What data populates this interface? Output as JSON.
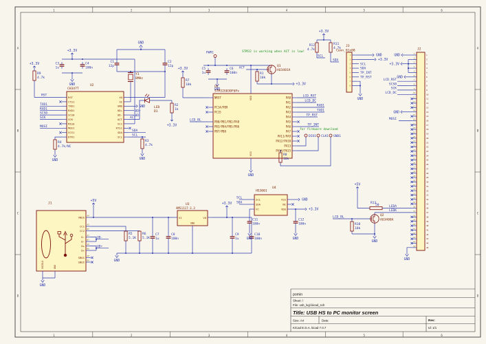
{
  "colors": {
    "bg": "#f8f5ec",
    "wire": "#2936ad",
    "symbol": "#7d0d0d",
    "fill": "#fdf6c3",
    "pin_number": "#7f7600",
    "pin_name": "#7d2500",
    "ic_text": "#7d2500",
    "comment": "#1f9522",
    "frame": "#3c3c3c",
    "titleblock": "#111111"
  },
  "frame": {
    "columns": [
      "1",
      "2",
      "3",
      "4",
      "5",
      "6"
    ],
    "rows": [
      "A",
      "B",
      "C",
      "D"
    ]
  },
  "title_block": {
    "author": "pomin",
    "sheet": "Sheet: /",
    "file": "File: usb_lvgl.kicad_sch",
    "title": "Title: USB HS to PC monitor screen",
    "size_label": "Size: A4",
    "date_label": "Date:",
    "rev_label": "Rev:",
    "tool": "KiCad E.D.A.  kicad 7.0.7",
    "id": "Id: 1/1"
  },
  "comments": {
    "act": "STM32 is working when ACT is low!",
    "firmware": "for firmware download"
  },
  "power": {
    "p3v3": "+3.3V",
    "p5v": "+5V",
    "gnd": "GND"
  },
  "net_labels": {
    "rst": "RST",
    "txd1": "TXD1",
    "rxd1": "RXD1",
    "scs0": "SCS0",
    "sck": "SCK",
    "mosi": "MOSI",
    "udp": "UD+",
    "udm": "UD-",
    "act": "ACT",
    "sda": "SDA",
    "scl": "SCL",
    "lcd_rst": "LCD_RST",
    "lcd_dc": "LCD_DC",
    "tp_rst": "TP_RST",
    "tp_int": "TP_INT",
    "lcd_bl": "LCD_BL",
    "leda": "LEDA",
    "ledk": "LEDK"
  },
  "testpoints": {
    "pwr": {
      "ref": "PWR1"
    },
    "dio": {
      "ref": "DIO1"
    },
    "clk": {
      "ref": "CLK1"
    },
    "gnd1": {
      "ref": "GND1"
    }
  },
  "resistors": {
    "R1": {
      "ref": "R1",
      "value": "10k"
    },
    "R2": {
      "ref": "R2",
      "value": "1k"
    },
    "R3": {
      "ref": "R3",
      "value": "4.7k"
    },
    "R4": {
      "ref": "R4",
      "value": "4.7k/NC"
    },
    "R5": {
      "ref": "R5",
      "value": "5.1K"
    },
    "R6": {
      "ref": "R6",
      "value": "5.1K"
    },
    "R7": {
      "ref": "R7",
      "value": "10k"
    },
    "R8": {
      "ref": "R8",
      "value": "10k"
    },
    "R9": {
      "ref": "R9",
      "value": "4.7k"
    },
    "R10": {
      "ref": "R10",
      "value": "10k"
    },
    "R11": {
      "ref": "R11",
      "value": "4.7k"
    },
    "R12": {
      "ref": "R12",
      "value": "4.7k"
    },
    "R13": {
      "ref": "R13",
      "value": "50"
    }
  },
  "capacitors": {
    "C1": {
      "ref": "C1",
      "value": "12p"
    },
    "C2": {
      "ref": "C2",
      "value": "12p"
    },
    "C3": {
      "ref": "C3",
      "value": "1u"
    },
    "C4": {
      "ref": "C4",
      "value": "100n"
    },
    "C5": {
      "ref": "C5",
      "value": "1u"
    },
    "C6": {
      "ref": "C6",
      "value": "100n"
    },
    "C7": {
      "ref": "C7",
      "value": "1u"
    },
    "C8": {
      "ref": "C8",
      "value": "100n"
    },
    "C9": {
      "ref": "C9",
      "value": "1u"
    },
    "C10": {
      "ref": "C10",
      "value": "100n"
    },
    "C11": {
      "ref": "C11",
      "value": "100n"
    },
    "C12": {
      "ref": "C12",
      "value": "100n"
    }
  },
  "components": {
    "U1": {
      "ref": "U1",
      "value": "STM32G030F6Px",
      "pin_top": "VDD",
      "pin_bottom": "VSS",
      "pins_left": [
        "NRST",
        "PC14/PB9",
        "PC15",
        "PB0/PB1/PB2/PA8",
        "PB3/PB4/PB5/PB6",
        "PB7/PB8"
      ],
      "pins_right": [
        "PA0",
        "PA1",
        "PA2",
        "PA3",
        "PA4",
        "PA5",
        "PA6",
        "PA7",
        "PA11/PA9",
        "PA12/PA10",
        "PA13",
        "PA14/PA15"
      ]
    },
    "U2": {
      "ref": "U2",
      "value": "CH347T",
      "pins_left": [
        "RST",
        "CTS1",
        "TXD1",
        "RXD1",
        "SCS0",
        "SCK",
        "MISO",
        "MOSI",
        "SCS1",
        "DTR1"
      ],
      "pins_right": [
        "XO",
        "XI",
        "GND",
        "UD+",
        "UD-",
        "ACT",
        "VCC",
        "RTS1",
        "SDA",
        "SCL"
      ]
    },
    "U3": {
      "ref": "U3",
      "value": "AMS1117-3.3",
      "pins": [
        "VI",
        "GND",
        "VO"
      ]
    },
    "U4": {
      "ref": "U4",
      "value": "HS3001",
      "pins_left": [
        "SCL",
        "SDA",
        "VC"
      ],
      "pins_right": [
        "VSS",
        "NC",
        "VDD"
      ]
    },
    "Q1": {
      "ref": "Q1",
      "value": "AO3401A"
    },
    "Q2": {
      "ref": "Q2",
      "value": "AO3400A"
    },
    "D1": {
      "ref": "D1",
      "value": "LED"
    },
    "Y1": {
      "ref": "Y1",
      "value": "8MHz"
    },
    "J1": {
      "ref": "J1",
      "value": "USB_C_Receptacle_USB2.0",
      "pin_numbers": [
        "A4",
        "A5",
        "B5",
        "A7",
        "B7",
        "A6",
        "B6",
        "A8",
        "B8"
      ],
      "pin_names": [
        "VBUS",
        "CC1",
        "CC2",
        "D-",
        "D-",
        "D+",
        "D+",
        "SBU1",
        "SBU2"
      ],
      "side_pins": [
        "SHIELD",
        "GND"
      ]
    },
    "J3": {
      "ref": "J3",
      "value": "Conn_01x08",
      "pin_numbers": [
        "1",
        "2",
        "3",
        "4",
        "5",
        "6",
        "7",
        "8"
      ]
    },
    "J2": {
      "ref": "J2",
      "pin_count": 45,
      "nets": {
        "1": "GND",
        "2": "+3.3V",
        "6": "GND",
        "7": "LCD_RST",
        "8": "SCS0",
        "9": "SCK",
        "10": "LCD_DC",
        "14": "GND",
        "16": "MOSI",
        "36": "LEDA",
        "37": "LEDK",
        "45": "GND"
      }
    }
  }
}
